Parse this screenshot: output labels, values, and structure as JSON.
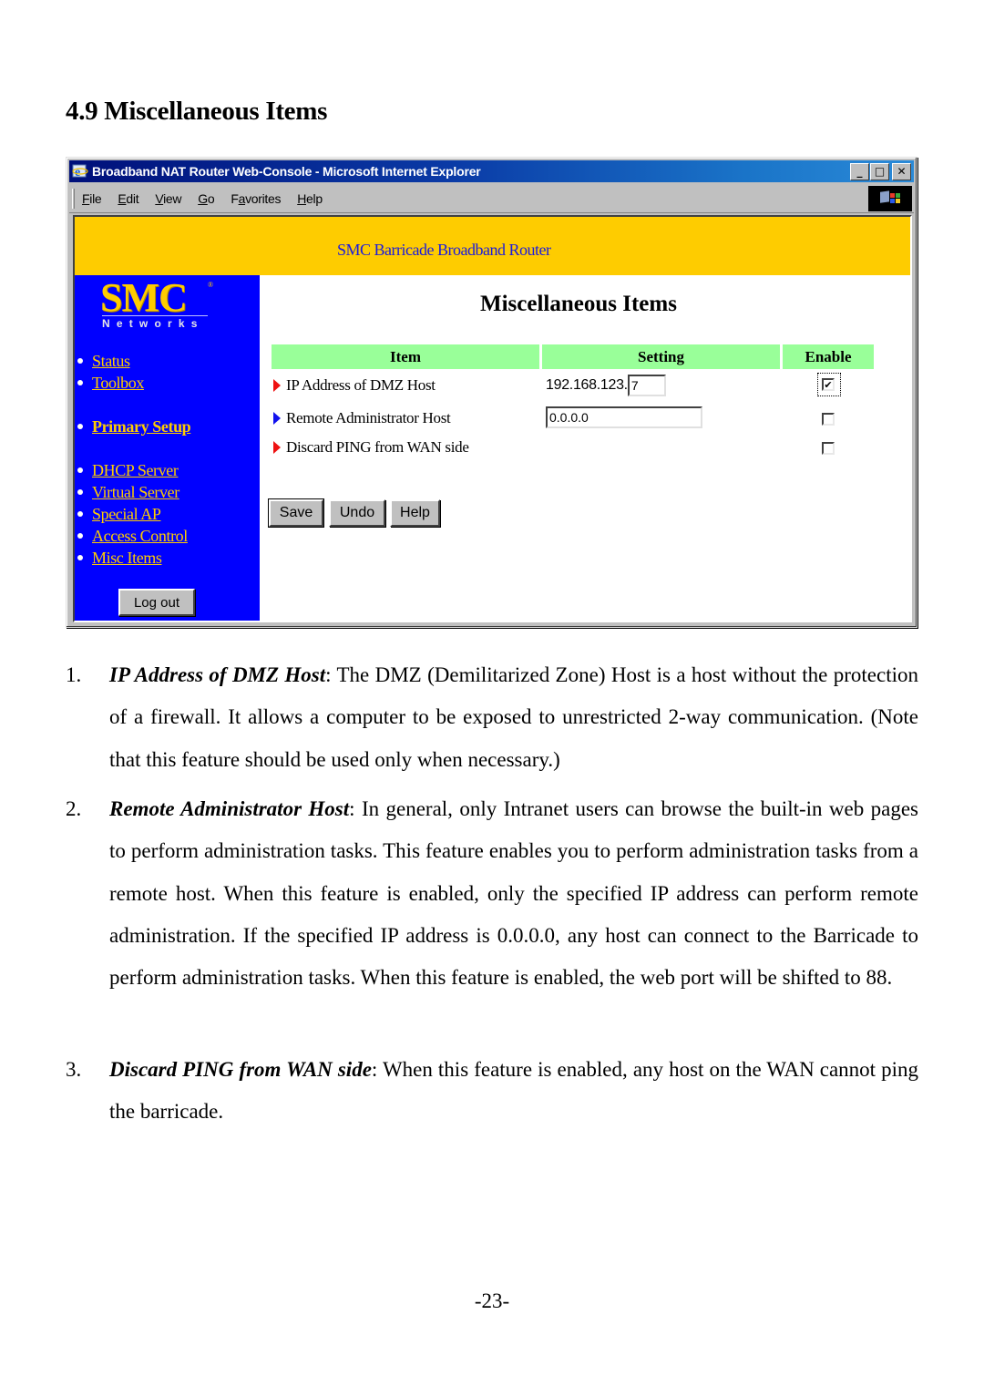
{
  "document": {
    "section_heading": "4.9 Miscellaneous Items",
    "page_number": "-23-"
  },
  "browser": {
    "title": "Broadband NAT Router Web-Console - Microsoft Internet Explorer",
    "window_controls": {
      "minimize": "_",
      "maximize": "□",
      "close": "✕"
    },
    "menu": [
      {
        "accel": "F",
        "rest": "ile"
      },
      {
        "accel": "E",
        "rest": "dit"
      },
      {
        "accel": "V",
        "rest": "iew"
      },
      {
        "accel": "G",
        "rest": "o"
      },
      {
        "pre": "F",
        "accel": "a",
        "rest": "vorites"
      },
      {
        "accel": "H",
        "rest": "elp"
      }
    ],
    "menu_labels": [
      "File",
      "Edit",
      "View",
      "Go",
      "Favorites",
      "Help"
    ]
  },
  "router": {
    "banner_title": "SMC Barricade Broadband Router",
    "logo": {
      "brand": "SMC",
      "registered": "®",
      "tagline": "Networks"
    },
    "nav": [
      {
        "label": "Status",
        "bold": false
      },
      {
        "label": "Toolbox",
        "bold": false
      },
      {
        "label": "Primary Setup",
        "bold": true
      },
      {
        "label": "DHCP Server",
        "bold": false
      },
      {
        "label": "Virtual Server",
        "bold": false
      },
      {
        "label": "Special AP",
        "bold": false
      },
      {
        "label": "Access Control",
        "bold": false
      },
      {
        "label": "Misc Items",
        "bold": false
      }
    ],
    "logout_label": "Log out",
    "page_title": "Miscellaneous Items",
    "table": {
      "headers": {
        "item": "Item",
        "setting": "Setting",
        "enable": "Enable"
      },
      "rows": [
        {
          "label": "IP Address of DMZ Host",
          "arrow_color": "#ee1111",
          "setting_prefix": "192.168.123.",
          "setting_value": "7",
          "enabled": true
        },
        {
          "label": "Remote Administrator Host",
          "arrow_color": "#1111ee",
          "setting_prefix": "",
          "setting_value": "0.0.0.0",
          "enabled": false
        },
        {
          "label": "Discard PING from WAN side",
          "arrow_color": "#ee1111",
          "setting_prefix": "",
          "setting_value": null,
          "enabled": false
        }
      ]
    },
    "buttons": {
      "save": "Save",
      "undo": "Undo",
      "help": "Help"
    },
    "colors": {
      "banner": "#fecc00",
      "sidebar": "#0000ff",
      "link": "#fecc00",
      "header_row": "#99ff99",
      "banner_text": "#1a1adf"
    }
  },
  "descriptions": [
    {
      "number": "1.",
      "term": "IP Address of DMZ Host",
      "text": ": The DMZ (Demilitarized Zone) Host is a host without the protection of a firewall. It allows a computer to be exposed to unrestricted 2-way communication. (Note that this feature should be used only when necessary.)"
    },
    {
      "number": "2.",
      "term": "Remote Administrator Host",
      "text": ": In general, only Intranet users can browse the built-in web pages to perform administration tasks. This feature enables you to perform administration tasks from a remote host. When this feature is enabled, only the specified IP address can perform remote administration. If the specified IP address is 0.0.0.0, any host can connect to the Barricade to perform administration tasks. When this feature is enabled, the web port will be shifted to 88."
    },
    {
      "number": "3.",
      "term": "Discard PING from WAN side",
      "text": ": When this feature is enabled, any host on the WAN cannot ping the barricade."
    }
  ]
}
